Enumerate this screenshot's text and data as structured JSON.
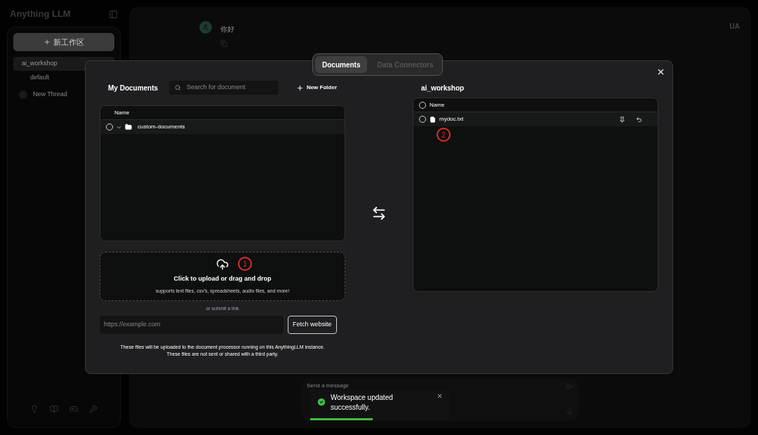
{
  "sidebar": {
    "brand": "Anything LLM",
    "new_workspace_button": "新工作区",
    "workspaces": [
      {
        "name": "ai_workshop",
        "selected": true,
        "threads": [
          {
            "name": "default"
          }
        ]
      }
    ],
    "new_thread": "New Thread"
  },
  "chat": {
    "greeting": "你好",
    "user_initials": "UA",
    "input_placeholder": "Send a message"
  },
  "modal": {
    "tabs": [
      {
        "label": "Documents",
        "selected": true
      },
      {
        "label": "Data Connectors",
        "selected": false
      }
    ],
    "my_documents": {
      "title": "My Documents",
      "search_placeholder": "Search for document",
      "new_folder": "New Folder",
      "column": "Name",
      "folders": [
        {
          "name": "custom-documents",
          "checked": false
        }
      ]
    },
    "upload": {
      "title": "Click to upload or drag and drop",
      "subtitle": "supports text files, csv's, spreadsheets, audio files, and more!",
      "marker": "1",
      "link_label": "or submit a link",
      "url_placeholder": "https://example.com",
      "fetch_button": "Fetch website",
      "notice": [
        "These files will be uploaded to the document processor running on this AnythingLLM instance.",
        "These files are not sent or shared with a third party."
      ]
    },
    "workspace": {
      "title": "ai_workshop",
      "column": "Name",
      "all_checked": false,
      "files": [
        {
          "name": "mydoc.txt",
          "checked": false
        }
      ],
      "marker": "2"
    }
  },
  "toast": {
    "message": "Workspace updated successfully.",
    "level": 0.45
  }
}
